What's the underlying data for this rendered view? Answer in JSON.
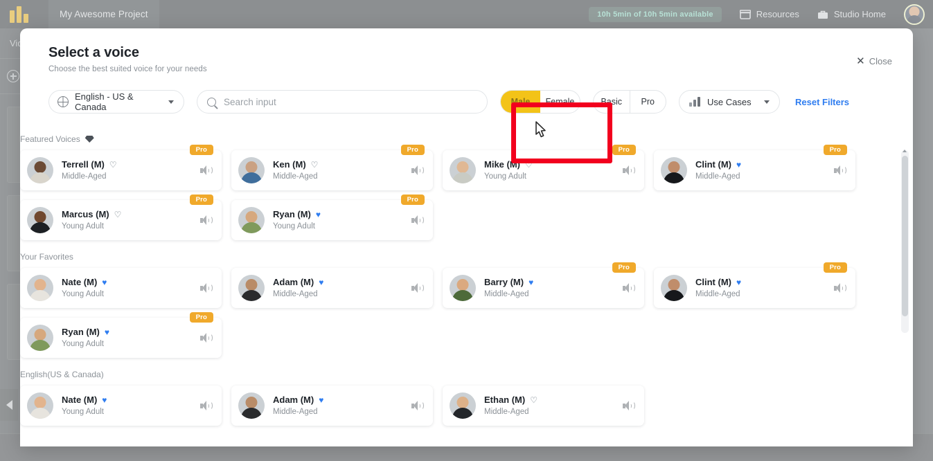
{
  "app": {
    "logo_icon": "brand-bars-logo",
    "project_tab": "My Awesome Project",
    "quota_badge": "10h 5min of 10h 5min available",
    "resources_label": "Resources",
    "resources_icon": "box-icon",
    "studio_home_label": "Studio Home",
    "studio_home_icon": "briefcase-icon",
    "avatar_icon": "user-avatar",
    "left_rail_label": "Vid",
    "add_icon": "plus-circle-icon",
    "collapse_icon": "chevron-left-icon"
  },
  "modal": {
    "title": "Select a voice",
    "subtitle": "Choose the best suited voice for your needs",
    "close_label": "Close",
    "close_icon": "close-icon"
  },
  "filters": {
    "language": "English - US & Canada",
    "language_icon": "globe-icon",
    "language_caret_icon": "chevron-down-icon",
    "search_placeholder": "Search input",
    "search_value": "",
    "search_icon": "search-icon",
    "gender": {
      "male": "Male",
      "female": "Female",
      "selected": "Male"
    },
    "plan": {
      "basic": "Basic",
      "pro": "Pro",
      "selected": ""
    },
    "use_cases_label": "Use Cases",
    "use_cases_icon": "bars-icon",
    "use_cases_caret_icon": "chevron-down-icon",
    "reset_label": "Reset Filters",
    "accent_yellow": "#f3c318",
    "accent_blue": "#2f7df0",
    "pro_orange": "#f0a92b"
  },
  "annotation": {
    "highlight_color": "#f2001e",
    "cursor_icon": "pointer-cursor",
    "target": "gender-toggle"
  },
  "sections": [
    {
      "label": "Featured Voices",
      "icon": "gem-icon",
      "voices": [
        {
          "name": "Terrell (M)",
          "age": "Middle-Aged",
          "pro": true,
          "favorite": false,
          "skin": "#6b4a35",
          "cloth": "#d9d5cc"
        },
        {
          "name": "Ken (M)",
          "age": "Middle-Aged",
          "pro": true,
          "favorite": false,
          "skin": "#caa182",
          "cloth": "#3f6e9c"
        },
        {
          "name": "Mike (M)",
          "age": "Young Adult",
          "pro": true,
          "favorite": false,
          "skin": "#e0b894",
          "cloth": "#c9cbc4"
        },
        {
          "name": "Clint (M)",
          "age": "Middle-Aged",
          "pro": true,
          "favorite": true,
          "skin": "#c08d6b",
          "cloth": "#16181b"
        },
        {
          "name": "Marcus (M)",
          "age": "Young Adult",
          "pro": true,
          "favorite": false,
          "skin": "#70482f",
          "cloth": "#1d2024"
        },
        {
          "name": "Ryan (M)",
          "age": "Young Adult",
          "pro": true,
          "favorite": true,
          "skin": "#d6a87e",
          "cloth": "#7f9a5c"
        }
      ]
    },
    {
      "label": "Your Favorites",
      "icon": "",
      "voices": [
        {
          "name": "Nate (M)",
          "age": "Young Adult",
          "pro": false,
          "favorite": true,
          "skin": "#e2b48e",
          "cloth": "#e7e4de"
        },
        {
          "name": "Adam (M)",
          "age": "Middle-Aged",
          "pro": false,
          "favorite": true,
          "skin": "#b98c68",
          "cloth": "#2a2b2d"
        },
        {
          "name": "Barry (M)",
          "age": "Middle-Aged",
          "pro": true,
          "favorite": true,
          "skin": "#dba97f",
          "cloth": "#4d6a3a"
        },
        {
          "name": "Clint (M)",
          "age": "Middle-Aged",
          "pro": true,
          "favorite": true,
          "skin": "#c08d6b",
          "cloth": "#16181b"
        },
        {
          "name": "Ryan (M)",
          "age": "Young Adult",
          "pro": true,
          "favorite": true,
          "skin": "#d6a87e",
          "cloth": "#7f9a5c"
        }
      ]
    },
    {
      "label": "English(US & Canada)",
      "icon": "",
      "voices": [
        {
          "name": "Nate (M)",
          "age": "Young Adult",
          "pro": false,
          "favorite": true,
          "skin": "#e2b48e",
          "cloth": "#e7e4de"
        },
        {
          "name": "Adam (M)",
          "age": "Middle-Aged",
          "pro": false,
          "favorite": true,
          "skin": "#b98c68",
          "cloth": "#2a2b2d"
        },
        {
          "name": "Ethan (M)",
          "age": "Middle-Aged",
          "pro": false,
          "favorite": false,
          "skin": "#ddb189",
          "cloth": "#23262a"
        }
      ]
    }
  ]
}
